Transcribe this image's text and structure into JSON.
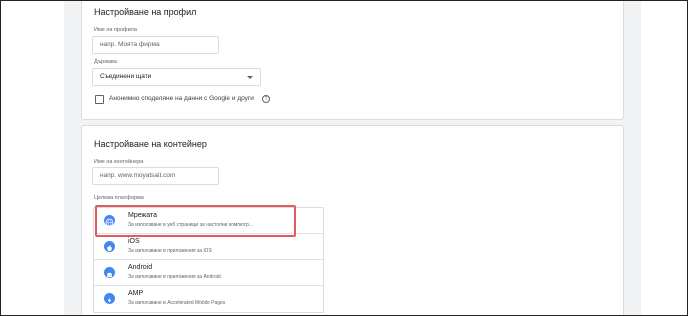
{
  "profile": {
    "title": "Настройване на профил",
    "name_label": "Име на профила",
    "name_placeholder": "напр. Моята фирма",
    "country_label": "Държава",
    "country_value": "Съединени щати",
    "share_label": "Анонимно споделяне на данни с Google и други"
  },
  "container": {
    "title": "Настройване на контейнер",
    "name_label": "Име на контейнера",
    "name_placeholder": "напр. www.moyatsait.com",
    "platform_label": "Целева платформа",
    "platforms": [
      {
        "title": "Мрежата",
        "desc": "За използване в уеб страници за настолни компютр...",
        "icon": "globe-icon"
      },
      {
        "title": "iOS",
        "desc": "За използване в приложения за iOS",
        "icon": "apple-icon"
      },
      {
        "title": "Android",
        "desc": "За използване в приложения за Android",
        "icon": "android-icon"
      },
      {
        "title": "AMP",
        "desc": "За използване в Accelerated Mobile Pages",
        "icon": "amp-bolt-icon"
      }
    ]
  },
  "colors": {
    "accent": "#4285f4",
    "highlight": "#e35b5f",
    "background": "#f1f3f4"
  }
}
